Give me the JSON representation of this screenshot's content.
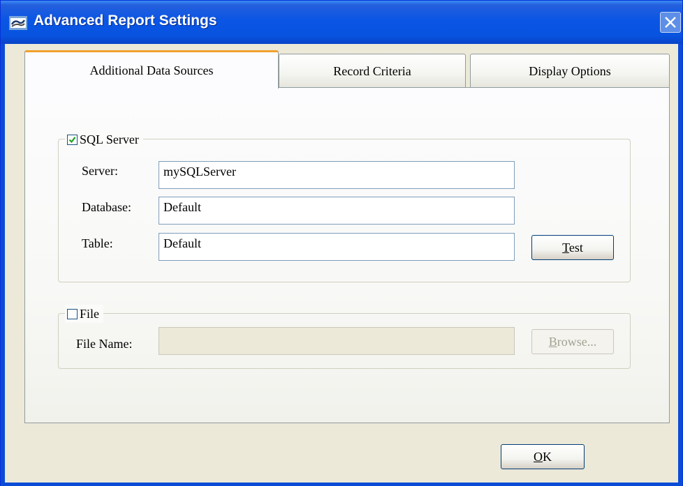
{
  "window": {
    "title": "Advanced Report Settings"
  },
  "tabs": [
    {
      "label": "Additional Data Sources",
      "active": true
    },
    {
      "label": "Record Criteria",
      "active": false
    },
    {
      "label": "Display Options",
      "active": false
    }
  ],
  "sql_server": {
    "label": "SQL Server",
    "checked": true,
    "server_label": "Server:",
    "server_value": "mySQLServer",
    "database_label": "Database:",
    "database_value": "Default",
    "table_label": "Table:",
    "table_value": "Default",
    "test_button": {
      "mnemonic": "T",
      "rest": "est"
    }
  },
  "file": {
    "label": "File",
    "checked": false,
    "file_name_label": "File Name:",
    "file_name_value": "",
    "browse_button": {
      "mnemonic": "B",
      "rest": "rowse..."
    }
  },
  "ok_button": {
    "mnemonic": "O",
    "rest": "K"
  },
  "icons": {
    "app": "app-icon",
    "close": "close-icon",
    "checkmark": "checkmark-icon"
  },
  "colors": {
    "titlebar": "#0a55e4",
    "dialog_bg": "#ece9d8",
    "active_tab_accent": "#f0a030",
    "check_green": "#21a121"
  }
}
